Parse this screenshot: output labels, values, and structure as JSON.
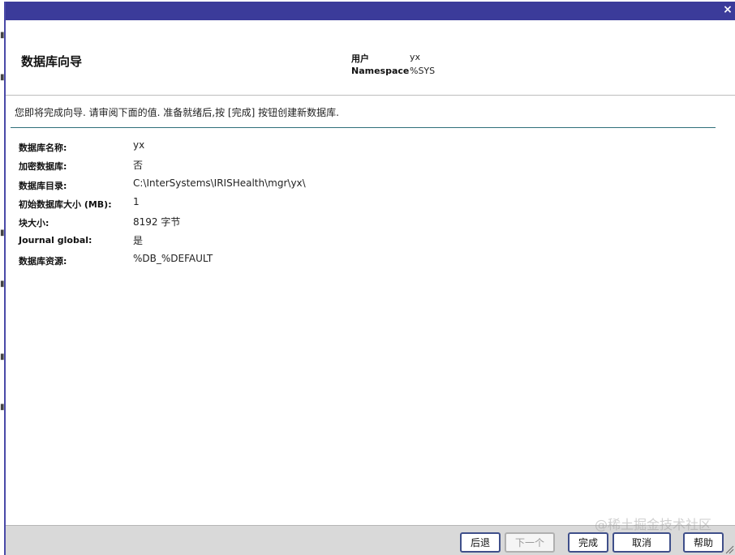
{
  "wizard": {
    "title": "数据库向导",
    "close_symbol": "×",
    "meta": {
      "user_label": "用户",
      "user_value": "yx",
      "namespace_label": "Namespace",
      "namespace_value": "%SYS"
    },
    "intro": "您即将完成向导. 请审阅下面的值. 准备就绪后,按 [完成] 按钮创建新数据库.",
    "summary": [
      {
        "label": "数据库名称:",
        "value": "yx"
      },
      {
        "label": "加密数据库:",
        "value": "否"
      },
      {
        "label": "数据库目录:",
        "value": "C:\\InterSystems\\IRISHealth\\mgr\\yx\\"
      },
      {
        "label": "初始数据库大小 (MB):",
        "value": "1"
      },
      {
        "label": "块大小:",
        "value": "8192 字节"
      },
      {
        "label": "Journal global:",
        "value": "是"
      },
      {
        "label": "数据库资源:",
        "value": "%DB_%DEFAULT"
      }
    ],
    "buttons": {
      "back": "后退",
      "next": "下一个",
      "finish": "完成",
      "cancel": "取消",
      "help": "帮助"
    },
    "watermark": "@稀土掘金技术社区"
  },
  "colors": {
    "titlebar": "#3b3b9a",
    "divider": "#2f6f7a",
    "button_border": "#3f4f8a",
    "footer": "#d9d9d9"
  }
}
